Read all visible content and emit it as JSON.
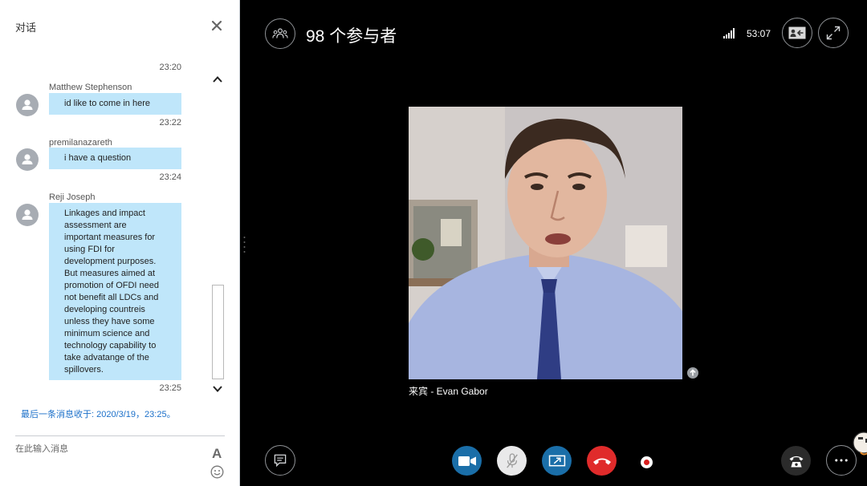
{
  "chat": {
    "title": "对话",
    "messages": [
      {
        "sender": "Matthew Stephenson",
        "text": "id like to come in here",
        "time_before": "23:20",
        "time_after": "23:22"
      },
      {
        "sender": "premilanazareth",
        "text": "i have a question",
        "time_after": "23:24"
      },
      {
        "sender": "Reji Joseph",
        "text": "Linkages and impact assessment are important measures for using FDI for development purposes. But measures aimed at promotion of OFDI need not benefit all LDCs and developing countreis unless they have some minimum science and technology capability to take advatange of the spillovers.",
        "time_after": "23:25"
      }
    ],
    "last_message": "最后一条消息收于: 2020/3/19，23:25。",
    "input_placeholder": "在此输入消息",
    "font_button": "A"
  },
  "top_bar": {
    "participants": "98 个参与者",
    "call_time": "53:07"
  },
  "video": {
    "caller_label": "来宾 - Evan Gabor"
  },
  "colors": {
    "bubble": "#bfe6fa",
    "accent_blue": "#1a6ea8",
    "hangup_red": "#e02b2b",
    "link_blue": "#1a6fc9"
  },
  "icons": {
    "participants": "people-group-icon",
    "signal": "signal-bars-icon",
    "layout": "contact-card-icon",
    "fullscreen": "expand-icon",
    "chat": "chat-bubble-icon",
    "video": "video-camera-icon",
    "mute": "microphone-muted-icon",
    "share": "screen-share-icon",
    "hangup": "hang-up-icon",
    "dialpad": "dialpad-phone-icon",
    "more": "more-dots-icon"
  }
}
